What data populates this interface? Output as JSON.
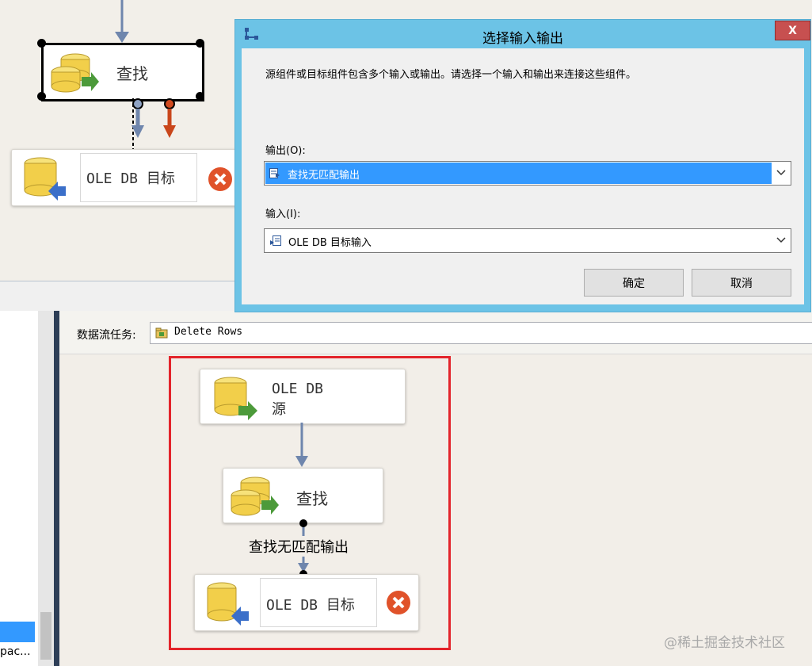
{
  "top_canvas": {
    "lookup_label": "查找",
    "dest_label": "OLE DB 目标"
  },
  "dialog": {
    "title": "选择输入输出",
    "close_glyph": "X",
    "description": "源组件或目标组件包含多个输入或输出。请选择一个输入和输出来连接这些组件。",
    "output_label": "输出(O):",
    "output_value": "查找无匹配输出",
    "input_label": "输入(I):",
    "input_value": "OLE DB 目标输入",
    "ok_button": "确定",
    "cancel_button": "取消"
  },
  "task_bar": {
    "label": "数据流任务:",
    "value": "Delete Rows"
  },
  "bottom_canvas": {
    "source_label_line1": "OLE DB",
    "source_label_line2": "源",
    "lookup_label": "查找",
    "path_label": "查找无匹配输出",
    "dest_label": "OLE DB 目标"
  },
  "left_panel": {
    "truncated_item": "pac..."
  },
  "watermark": "@稀土掘金技术社区",
  "colors": {
    "dialog_titlebar": "#6cc3e6",
    "close_button": "#c75050",
    "selection": "#3399ff",
    "highlight_frame": "#e3242b",
    "error_icon": "#e0522a",
    "flow_arrow": "#6f86ad",
    "error_arrow": "#c9461b"
  }
}
